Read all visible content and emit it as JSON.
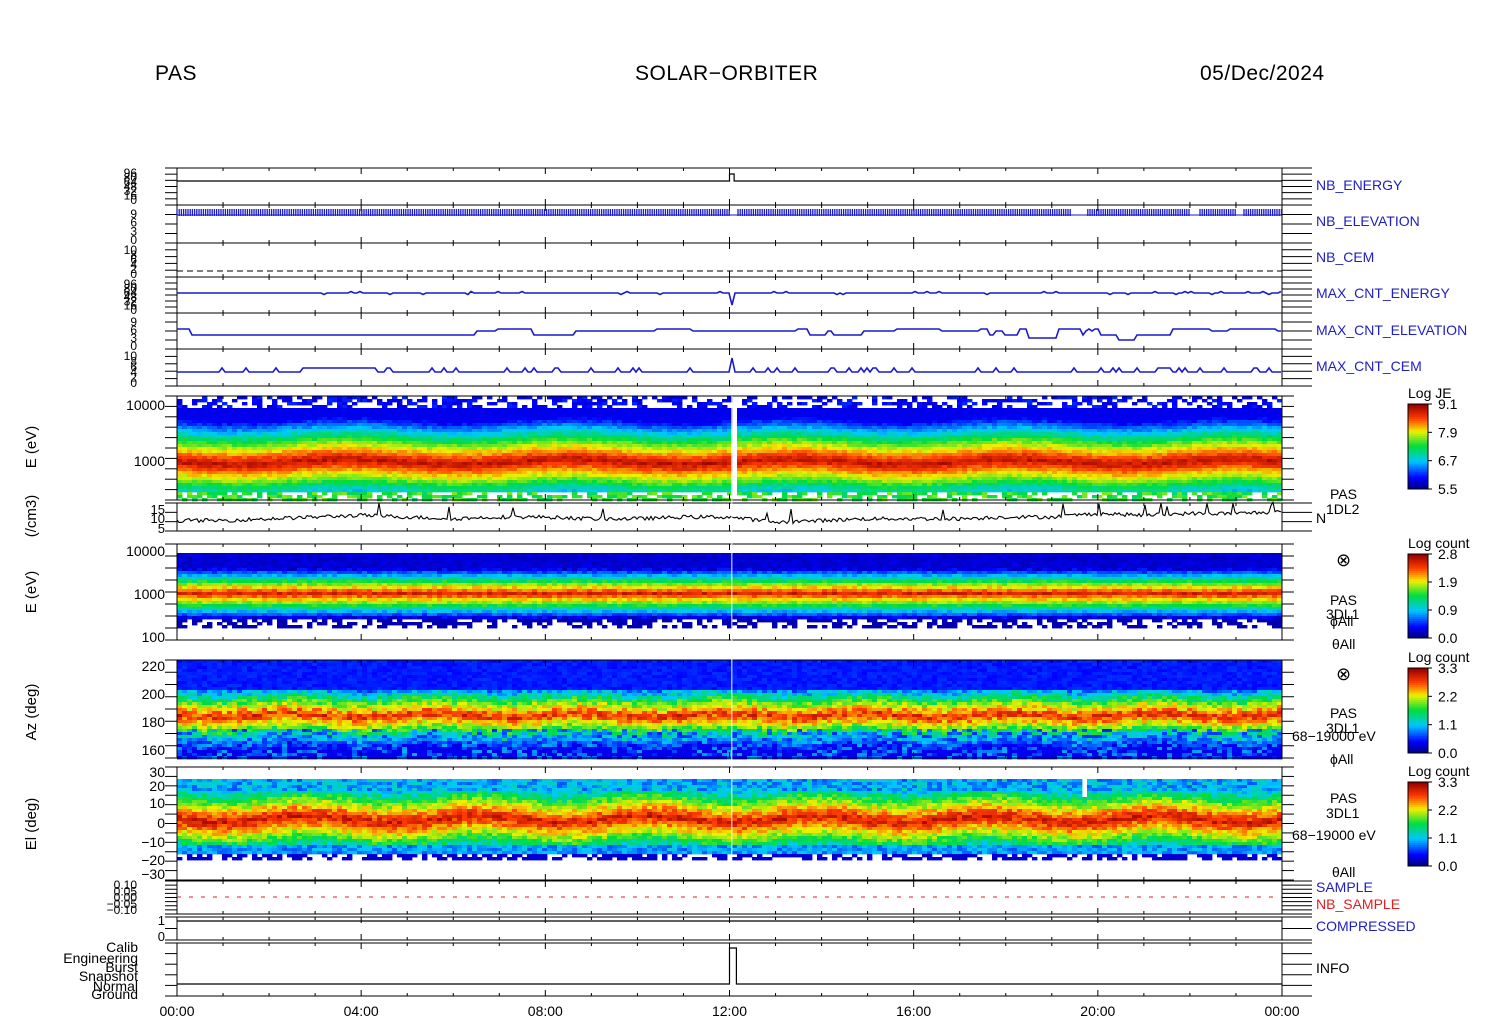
{
  "header": {
    "left": "PAS",
    "center": "SOLAR−ORBITER",
    "right": "05/Dec/2024"
  },
  "colors": {
    "hk_blue": "#1a1acc",
    "sample_red": "#e02020",
    "trace_black": "#000000"
  },
  "chart_data": [
    {
      "type": "line",
      "name": "NB_ENERGY",
      "label": "NB_ENERGY",
      "label_color": "#2020c0",
      "ytick_labels": [
        "96",
        "80",
        "64",
        "48",
        "32",
        "16",
        "0"
      ],
      "x": [
        "00:00",
        "12:00",
        "12:06",
        "12:06",
        "24:00"
      ],
      "y": [
        0,
        0,
        90,
        0,
        0
      ]
    },
    {
      "type": "line",
      "name": "NB_ELEVATION",
      "label": "NB_ELEVATION",
      "label_color": "#2020c0",
      "ytick_labels": [
        "9",
        "6",
        "3",
        "0"
      ],
      "note_values": "dense oscillation between 7 and 8 throughout the day; gaps near 12:06, 19:25-19:45, 22:00-22:10, 23:00-23:10"
    },
    {
      "type": "line",
      "name": "NB_CEM",
      "label": "NB_CEM",
      "label_color": "#2020c0",
      "ytick_labels": [
        "10",
        "8",
        "6",
        "4",
        "2",
        "0"
      ],
      "y_constant": 2,
      "style": "dashed"
    },
    {
      "type": "line",
      "name": "MAX_CNT_ENERGY",
      "label": "MAX_CNT_ENERGY",
      "label_color": "#2020c0",
      "ytick_labels": [
        "96",
        "80",
        "64",
        "48",
        "32",
        "16",
        "0"
      ],
      "y_typical": 56
    },
    {
      "type": "line",
      "name": "MAX_CNT_ELEVATION",
      "label": "MAX_CNT_ELEVATION",
      "label_color": "#2020c0",
      "ytick_labels": [
        "9",
        "6",
        "3",
        "0"
      ],
      "y_typical": 4
    },
    {
      "type": "line",
      "name": "MAX_CNT_CEM",
      "label": "MAX_CNT_CEM",
      "label_color": "#2020c0",
      "ytick_labels": [
        "10",
        "8",
        "6",
        "4",
        "2",
        "0"
      ],
      "y_typical": 1
    },
    {
      "type": "heatmap",
      "name": "energy_spectrogram_JE",
      "ylabel": "E (eV)",
      "yscale": "log",
      "ytick_labels": [
        "10000",
        "1000"
      ],
      "ylim": [
        200,
        17000
      ],
      "colorbar": {
        "title": "Log JE",
        "ticks": [
          "9.1",
          "7.9",
          "6.7",
          "5.5"
        ],
        "range": [
          5.5,
          9.1
        ]
      },
      "peak_energy_eV": 750,
      "gap": [
        "12:02",
        "12:06"
      ]
    },
    {
      "type": "line",
      "name": "density",
      "ylabel": "(/cm3)",
      "ytick_labels": [
        "15",
        "10",
        "5"
      ],
      "ylim": [
        0,
        16
      ],
      "side_label": [
        "PAS",
        "1DL2",
        "N"
      ],
      "x_hours": [
        0,
        1,
        2,
        3,
        4,
        5,
        6,
        7,
        8,
        9,
        10,
        11,
        12,
        13,
        14,
        15,
        16,
        17,
        18,
        19,
        20,
        21,
        22,
        23,
        24
      ],
      "y": [
        6,
        6,
        7,
        8,
        9,
        8,
        7,
        8,
        8,
        7,
        7,
        8,
        8,
        5,
        6,
        7,
        7,
        7,
        8,
        8,
        10,
        9,
        10,
        10,
        11
      ]
    },
    {
      "type": "heatmap",
      "name": "energy_spectrogram_3DL1",
      "ylabel": "E (eV)",
      "yscale": "log",
      "ytick_labels": [
        "10000",
        "1000",
        "100"
      ],
      "ylim": [
        60,
        13000
      ],
      "colorbar": {
        "title": "Log count",
        "ticks": [
          "2.8",
          "1.9",
          "0.9",
          "0.0"
        ],
        "range": [
          0,
          2.8
        ]
      },
      "side_label": [
        "⊗",
        "PAS",
        "3DL1",
        "ϕAll",
        "θAll"
      ],
      "peak_energy_eV": 850
    },
    {
      "type": "heatmap",
      "name": "azimuth_spectrogram",
      "ylabel": "Az (deg)",
      "ytick_labels": [
        "220",
        "200",
        "180",
        "160"
      ],
      "ylim": [
        153,
        225
      ],
      "colorbar": {
        "title": "Log count",
        "ticks": [
          "3.3",
          "2.2",
          "1.1",
          "0.0"
        ],
        "range": [
          0,
          3.3
        ]
      },
      "side_label": [
        "⊗",
        "PAS",
        "3DL1",
        "68−19000 eV",
        "ϕAll"
      ],
      "peak_deg": 183
    },
    {
      "type": "heatmap",
      "name": "elevation_spectrogram",
      "ylabel": "El (deg)",
      "ytick_labels": [
        "30",
        "20",
        "10",
        "0",
        "−10",
        "−20",
        "−30"
      ],
      "ylim": [
        -30,
        30
      ],
      "colorbar": {
        "title": "Log count",
        "ticks": [
          "3.3",
          "2.2",
          "1.1",
          "0.0"
        ],
        "range": [
          0,
          3.3
        ]
      },
      "side_label": [
        "PAS",
        "3DL1",
        "68−19000 eV",
        "θAll"
      ],
      "peak_deg": 5
    },
    {
      "type": "line",
      "name": "SAMPLE",
      "labels": [
        "SAMPLE",
        "NB_SAMPLE"
      ],
      "label_colors": [
        "#2020c0",
        "#e02020"
      ],
      "ytick_labels": [
        "0.10",
        "0.05",
        "0.00",
        "−0.05",
        "−0.10"
      ],
      "ylim": [
        -0.1,
        0.1
      ],
      "y_constant": 0
    },
    {
      "type": "line",
      "name": "COMPRESSED",
      "label": "COMPRESSED",
      "label_color": "#2020c0",
      "ytick_labels": [
        "1",
        "0"
      ],
      "y_constant": 1
    },
    {
      "type": "line",
      "name": "INFO",
      "label": "INFO",
      "ytick_labels": [
        "Calib",
        "Engineering",
        "Burst",
        "Snapshot",
        "Normal",
        "Ground"
      ],
      "x": [
        "00:00",
        "12:00",
        "12:00",
        "12:10",
        "12:10",
        "24:00"
      ],
      "y": [
        "Normal",
        "Normal",
        "Calib",
        "Calib",
        "Normal",
        "Normal"
      ]
    },
    {
      "type": "axis",
      "name": "time_axis",
      "xtick_labels": [
        "00:00",
        "04:00",
        "08:00",
        "12:00",
        "16:00",
        "20:00",
        "00:00"
      ]
    }
  ]
}
